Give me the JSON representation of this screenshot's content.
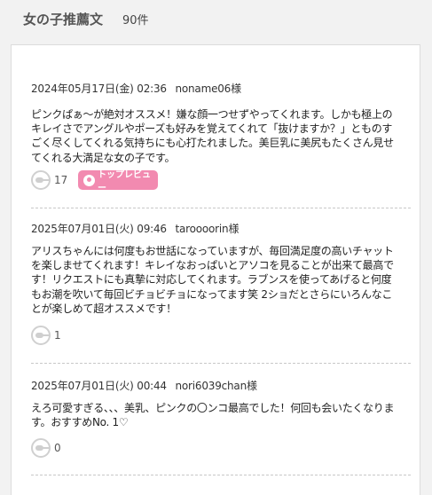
{
  "header": {
    "title": "女の子推薦文",
    "count": "90件"
  },
  "reviews": [
    {
      "date": "2024年05月17日(金) 02:36",
      "author": "noname06様",
      "text": "ピンクぱぁ～が絶対オススメ！嫌な顔一つせずやってくれます。しかも極上のキレイさでアングルやポーズも好みを覚えてくれて「抜けますか？」とものすごく尽くしてくれる気持ちにも心打たれました。美巨乳に美尻もたくさん見せてくれる大満足な女の子です。",
      "likes": "17",
      "badge": "トップレビュー"
    },
    {
      "date": "2025年07月01日(火) 09:46",
      "author": "taroooorin様",
      "text": "アリスちゃんには何度もお世話になっていますが、毎回満足度の高いチャットを楽しませてくれます！キレイなおっぱいとアソコを見ることが出来て最高です！リクエストにも真摯に対応してくれます。ラブンスを使ってあげると何度もお潮を吹いて毎回ビチョビチョになってます笑 2ショだとさらにいろんなことが楽しめて超オススメです！",
      "likes": "1"
    },
    {
      "date": "2025年07月01日(火) 00:44",
      "author": "nori6039chan様",
      "text": "えろ可愛すぎる、、、美乳、ピンクの〇ンコ最高でした！何回も会いたくなります。おすすめNo. 1♡",
      "likes": "0"
    }
  ],
  "colors": {
    "badge_pink": "#f28ab0",
    "background": "#f2f2f2",
    "panel": "#ffffff"
  }
}
